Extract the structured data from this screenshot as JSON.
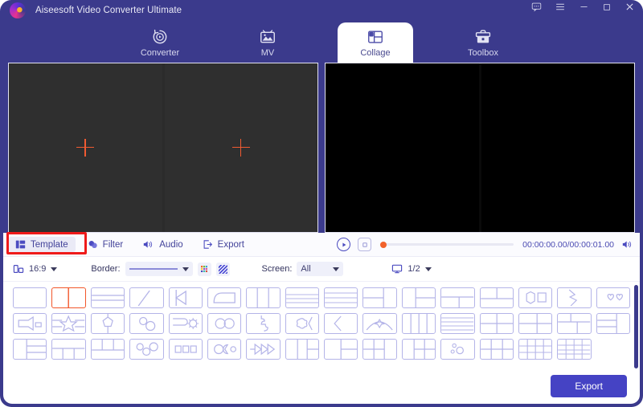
{
  "window": {
    "title": "Aiseesoft Video Converter Ultimate",
    "controls": [
      {
        "name": "feedback-icon",
        "glyph": "chat"
      },
      {
        "name": "menu-icon",
        "glyph": "hamburger"
      },
      {
        "name": "minimize-icon",
        "glyph": "minimize"
      },
      {
        "name": "maximize-icon",
        "glyph": "maximize"
      },
      {
        "name": "close-icon",
        "glyph": "close"
      }
    ]
  },
  "nav": {
    "tabs": [
      {
        "label": "Converter",
        "icon": "converter-icon",
        "active": false
      },
      {
        "label": "MV",
        "icon": "mv-icon",
        "active": false
      },
      {
        "label": "Collage",
        "icon": "collage-icon",
        "active": true
      },
      {
        "label": "Toolbox",
        "icon": "toolbox-icon",
        "active": false
      }
    ]
  },
  "preview": {
    "editor": {
      "cells": 2,
      "placeholder_icon": "plus-icon",
      "accent": "#f05a32"
    },
    "player": {
      "cells": 2,
      "background": "#000000"
    }
  },
  "toolbar": {
    "items": [
      {
        "label": "Template",
        "icon": "template-icon",
        "selected": true
      },
      {
        "label": "Filter",
        "icon": "filter-icon",
        "selected": false
      },
      {
        "label": "Audio",
        "icon": "audio-icon",
        "selected": false
      },
      {
        "label": "Export",
        "icon": "export-icon",
        "selected": false
      }
    ],
    "play_icon": "play-icon",
    "stop_icon": "stop-icon",
    "volume_icon": "volume-icon",
    "time": "00:00:00.00/00:00:01.00",
    "progress_percent": 0
  },
  "options": {
    "aspect_icon": "aspect-ratio-icon",
    "aspect_value": "16:9",
    "border_label": "Border:",
    "border_style_value": "solid-line",
    "border_color_icon": "color-picker-icon",
    "border_pattern_icon": "pattern-icon",
    "screen_label": "Screen:",
    "screen_value": "All",
    "monitor_icon": "monitor-icon",
    "page_value": "1/2"
  },
  "templates": {
    "selected_index": 1,
    "tiles": [
      {
        "name": "template-single",
        "shape": "single"
      },
      {
        "name": "template-two-vertical",
        "shape": "two-v"
      },
      {
        "name": "template-two-horizontal-offset",
        "shape": "two-h-offset"
      },
      {
        "name": "template-diagonal-split",
        "shape": "diagonal"
      },
      {
        "name": "template-arrow-notch",
        "shape": "arrow-notch"
      },
      {
        "name": "template-rounded-inset",
        "shape": "rounded-inset"
      },
      {
        "name": "template-three-vertical",
        "shape": "three-v"
      },
      {
        "name": "template-three-horizontal",
        "shape": "three-h"
      },
      {
        "name": "template-four-horizontal",
        "shape": "four-h"
      },
      {
        "name": "template-left-split-right",
        "shape": "left-split-right"
      },
      {
        "name": "template-right-split-left",
        "shape": "right-split-left"
      },
      {
        "name": "template-top-bottom-split",
        "shape": "top-bottom-split"
      },
      {
        "name": "template-bottom-top-split",
        "shape": "bottom-top-split"
      },
      {
        "name": "template-hex-square",
        "shape": "hex-square"
      },
      {
        "name": "template-zigzag-split",
        "shape": "zigzag"
      },
      {
        "name": "template-two-hearts",
        "shape": "two-hearts"
      },
      {
        "name": "template-megaphone",
        "shape": "megaphone"
      },
      {
        "name": "template-star-band",
        "shape": "star-band"
      },
      {
        "name": "template-pentagon-center",
        "shape": "pentagon"
      },
      {
        "name": "template-two-circles-small",
        "shape": "two-circles-sm"
      },
      {
        "name": "template-flag-gear",
        "shape": "flag-gear"
      },
      {
        "name": "template-double-circle",
        "shape": "double-circle"
      },
      {
        "name": "template-puzzle-split",
        "shape": "puzzle"
      },
      {
        "name": "template-flower-bracket",
        "shape": "flower-bracket"
      },
      {
        "name": "template-bracket-left",
        "shape": "bracket-left"
      },
      {
        "name": "template-dome-star",
        "shape": "dome-star"
      },
      {
        "name": "template-four-columns",
        "shape": "four-cols"
      },
      {
        "name": "template-five-rows",
        "shape": "five-rows"
      },
      {
        "name": "template-quad",
        "shape": "quad"
      },
      {
        "name": "template-left-big-two-right",
        "shape": "left-big-2r"
      },
      {
        "name": "template-top-two-bottom-wide",
        "shape": "top2-bot-wide"
      },
      {
        "name": "template-two-rows-left-big-right",
        "shape": "two-rows-left"
      },
      {
        "name": "template-left-right-split-rows",
        "shape": "left-right-rows"
      },
      {
        "name": "template-top-wide-three-bottom",
        "shape": "top-wide-3b"
      },
      {
        "name": "template-three-top-wide-bottom",
        "shape": "three-top-wide"
      },
      {
        "name": "template-three-circles",
        "shape": "three-circles"
      },
      {
        "name": "template-three-squares",
        "shape": "three-squares"
      },
      {
        "name": "template-circle-pac-circle",
        "shape": "circle-pac"
      },
      {
        "name": "template-triple-arrow",
        "shape": "triple-arrow"
      },
      {
        "name": "template-left-rows-right",
        "shape": "left-rows-right"
      },
      {
        "name": "template-split-half-rows",
        "shape": "split-half-rows"
      },
      {
        "name": "template-quad-right-big",
        "shape": "quad-right-big"
      },
      {
        "name": "template-left-big-quad",
        "shape": "left-big-quad"
      },
      {
        "name": "template-bubbles",
        "shape": "bubbles"
      },
      {
        "name": "template-six-grid",
        "shape": "six-grid"
      },
      {
        "name": "template-eight-grid",
        "shape": "eight-grid"
      },
      {
        "name": "template-nine-mixed-grid",
        "shape": "nine-mixed"
      }
    ]
  },
  "footer": {
    "export_label": "Export"
  },
  "annotation": {
    "target": "Template",
    "color": "#ef1a1a"
  },
  "colors": {
    "window_bg": "#3b3a8c",
    "panel_bg": "#ffffff",
    "accent_purple": "#4543c4",
    "tile_border": "#b4b4e8",
    "selected_tile": "#f2562a"
  }
}
